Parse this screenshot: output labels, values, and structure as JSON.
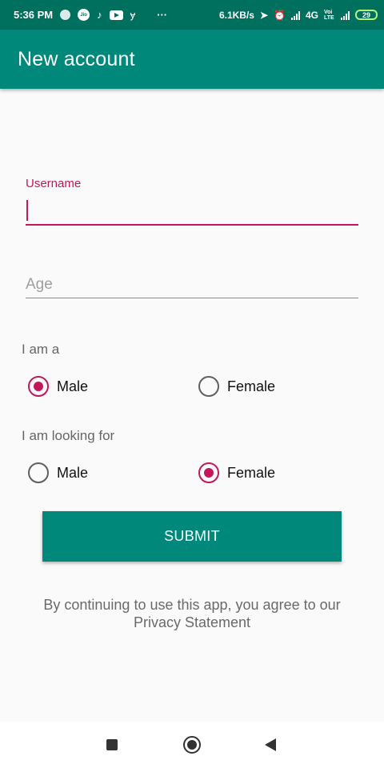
{
  "status_bar": {
    "time": "5:36 PM",
    "network_speed": "6.1KB/s",
    "network_type": "4G",
    "volte": "Voi LTE",
    "battery": "29",
    "more": "···",
    "icons": [
      "circle-icon",
      "jio-icon",
      "tiktok-icon",
      "youtube-icon",
      "y-icon",
      "location-icon",
      "alarm-icon",
      "signal-icon",
      "battery-icon"
    ]
  },
  "app_bar": {
    "title": "New account"
  },
  "form": {
    "username_label": "Username",
    "username_value": "",
    "age_placeholder": "Age",
    "age_value": "",
    "i_am_label": "I am a",
    "i_am_options": [
      {
        "label": "Male",
        "checked": true
      },
      {
        "label": "Female",
        "checked": false
      }
    ],
    "looking_for_label": "I am looking for",
    "looking_for_options": [
      {
        "label": "Male",
        "checked": false
      },
      {
        "label": "Female",
        "checked": true
      }
    ],
    "submit_label": "SUBMIT",
    "privacy_text": "By continuing to use this app, you agree to our Privacy Statement"
  },
  "colors": {
    "primary": "#00897b",
    "primary_dark": "#00705e",
    "accent": "#c2185b"
  },
  "nav_bar": {
    "icons": [
      "recents-icon",
      "home-icon",
      "back-icon"
    ]
  }
}
